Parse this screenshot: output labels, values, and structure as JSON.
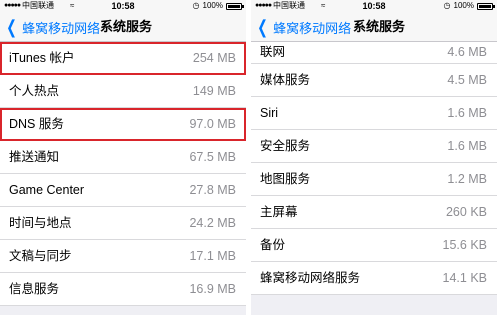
{
  "status_bar": {
    "carrier": "中国联通",
    "time": "10:58",
    "battery": "100%",
    "battery_level": 1.0
  },
  "nav": {
    "back_label": "蜂窝移动网络",
    "title": "系统服务"
  },
  "left_items": [
    {
      "label": "iTunes 帐户",
      "size": "254 MB",
      "highlighted": true
    },
    {
      "label": "个人热点",
      "size": "149 MB",
      "highlighted": false
    },
    {
      "label": "DNS 服务",
      "size": "97.0 MB",
      "highlighted": true
    },
    {
      "label": "推送通知",
      "size": "67.5 MB",
      "highlighted": false
    },
    {
      "label": "Game Center",
      "size": "27.8 MB",
      "highlighted": false
    },
    {
      "label": "时间与地点",
      "size": "24.2 MB",
      "highlighted": false
    },
    {
      "label": "文稿与同步",
      "size": "17.1 MB",
      "highlighted": false
    },
    {
      "label": "信息服务",
      "size": "16.9 MB",
      "highlighted": false
    }
  ],
  "right_items": [
    {
      "label": "联网",
      "size": "4.6 MB"
    },
    {
      "label": "媒体服务",
      "size": "4.5 MB"
    },
    {
      "label": "Siri",
      "size": "1.6 MB"
    },
    {
      "label": "安全服务",
      "size": "1.6 MB"
    },
    {
      "label": "地图服务",
      "size": "1.2 MB"
    },
    {
      "label": "主屏幕",
      "size": "260 KB"
    },
    {
      "label": "备份",
      "size": "15.6 KB"
    },
    {
      "label": "蜂窝移动网络服务",
      "size": "14.1 KB"
    }
  ],
  "colors": {
    "accent": "#007aff",
    "highlight": "#d9252b",
    "secondary_text": "#8e8e93"
  },
  "icons": [
    "signal-icon",
    "wifi-icon",
    "alarm-icon",
    "battery-icon",
    "chevron-left-icon"
  ]
}
